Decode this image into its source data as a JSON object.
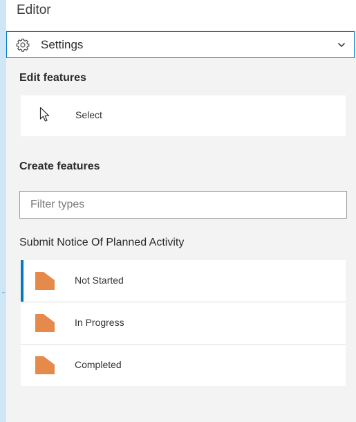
{
  "header": {
    "title": "Editor"
  },
  "settings": {
    "label": "Settings"
  },
  "edit_features": {
    "title": "Edit features",
    "select_label": "Select"
  },
  "create_features": {
    "title": "Create features",
    "filter_placeholder": "Filter types"
  },
  "layer_group": {
    "title": "Submit Notice Of Planned Activity",
    "swatch_color": "#e58a4b",
    "items": [
      {
        "label": "Not Started",
        "active": true
      },
      {
        "label": "In Progress",
        "active": false
      },
      {
        "label": "Completed",
        "active": false
      }
    ]
  },
  "colors": {
    "accent": "#007ac2",
    "background": "#f3f3f3"
  }
}
